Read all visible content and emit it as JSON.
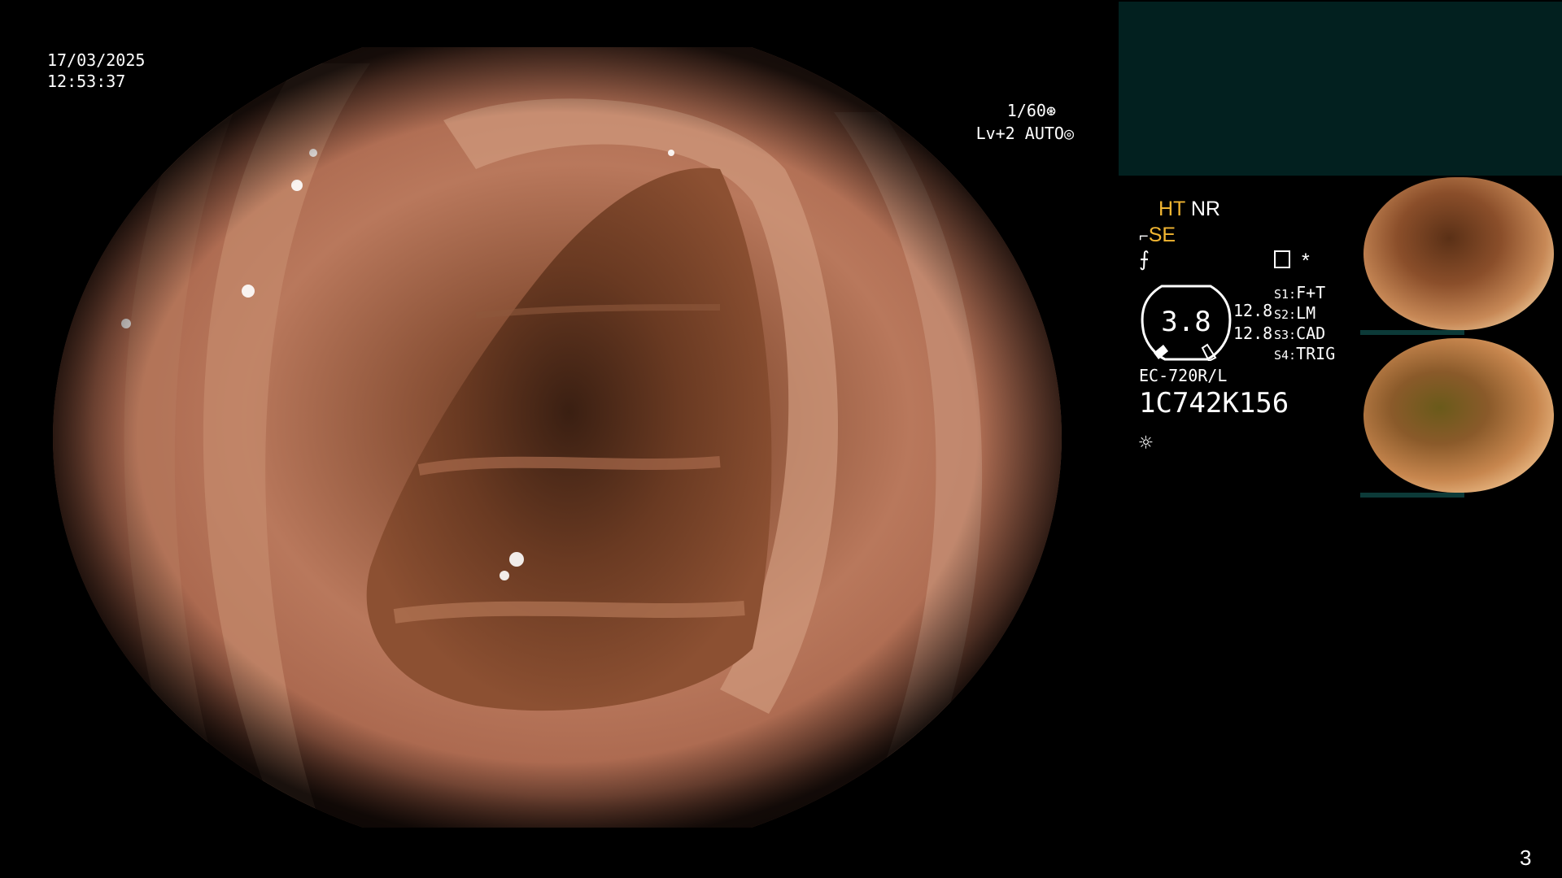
{
  "datetime": {
    "date": "17/03/2025",
    "time": "12:53:37"
  },
  "shutter": {
    "speed": "1/60",
    "level": "Lv+2",
    "mode": "AUTO"
  },
  "settings": {
    "ht": "HT",
    "nr": "NR",
    "se": "SE",
    "gauge_value": "3.8",
    "value_1": "12.8",
    "value_2": "12.8",
    "s1": {
      "key": "S1:",
      "value": "F+T"
    },
    "s2": {
      "key": "S2:",
      "value": "LM"
    },
    "s3": {
      "key": "S3:",
      "value": "CAD"
    },
    "s4": {
      "key": "S4:",
      "value": "TRIG"
    },
    "asterisk": "*"
  },
  "scope": {
    "model": "EC-720R/L",
    "serial": "1C742K156"
  },
  "page_number": "3",
  "colors": {
    "accent": "#f2b632",
    "panel": "#02201f",
    "background": "#000000"
  },
  "icons": [
    "shutter-icon",
    "auto-iris-icon",
    "focus-icon",
    "filter-icon",
    "memory-icon",
    "light-icon"
  ]
}
